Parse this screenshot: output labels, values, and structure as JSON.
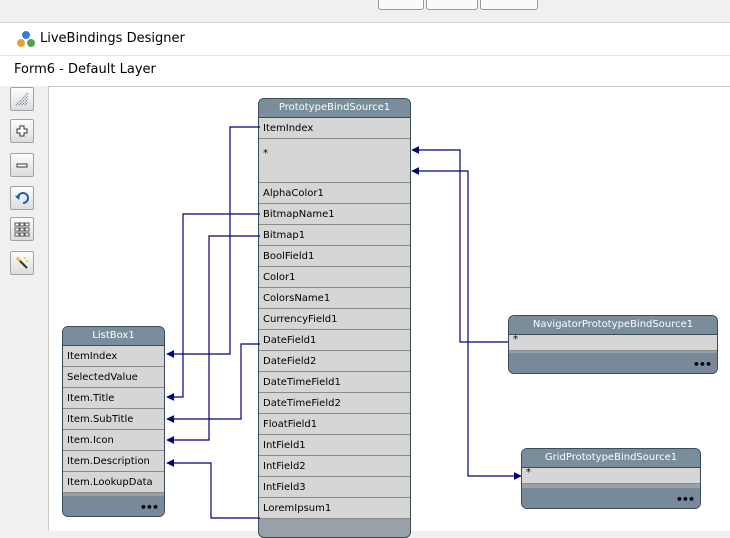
{
  "window": {
    "title": "LiveBindings Designer"
  },
  "layer": {
    "label": "Form6  - Default Layer"
  },
  "toolbar": {
    "buttons": [
      {
        "name": "arrange-grid-button",
        "icon": "diagonal-grid-icon"
      },
      {
        "name": "zoom-in-button",
        "icon": "plus-magnifier-icon"
      },
      {
        "name": "zoom-out-button",
        "icon": "minus-icon"
      },
      {
        "name": "undo-button",
        "icon": "undo-arrow-icon"
      },
      {
        "name": "layout-button",
        "icon": "grid-layout-icon"
      },
      {
        "name": "wizard-button",
        "icon": "magic-wand-icon"
      }
    ]
  },
  "nodes": {
    "prototype": {
      "title": "PrototypeBindSource1",
      "fields": [
        "ItemIndex",
        "*",
        "AlphaColor1",
        "BitmapName1",
        "Bitmap1",
        "BoolField1",
        "Color1",
        "ColorsName1",
        "CurrencyField1",
        "DateField1",
        "DateField2",
        "DateTimeField1",
        "DateTimeField2",
        "FloatField1",
        "IntField1",
        "IntField2",
        "IntField3",
        "LoremIpsum1"
      ]
    },
    "listbox": {
      "title": "ListBox1",
      "fields": [
        "ItemIndex",
        "SelectedValue",
        "Item.Title",
        "Item.SubTitle",
        "Item.Icon",
        "Item.Description",
        "Item.LookupData"
      ],
      "more": "•••"
    },
    "navigator": {
      "title": "NavigatorPrototypeBindSource1",
      "fields": [
        "*"
      ],
      "more": "•••"
    },
    "grid": {
      "title": "GridPrototypeBindSource1",
      "fields": [
        "*"
      ],
      "more": "•••"
    }
  },
  "colors": {
    "link": "#000080",
    "node_header": "#7a8d9b",
    "field_bg": "#d6d6d6"
  }
}
